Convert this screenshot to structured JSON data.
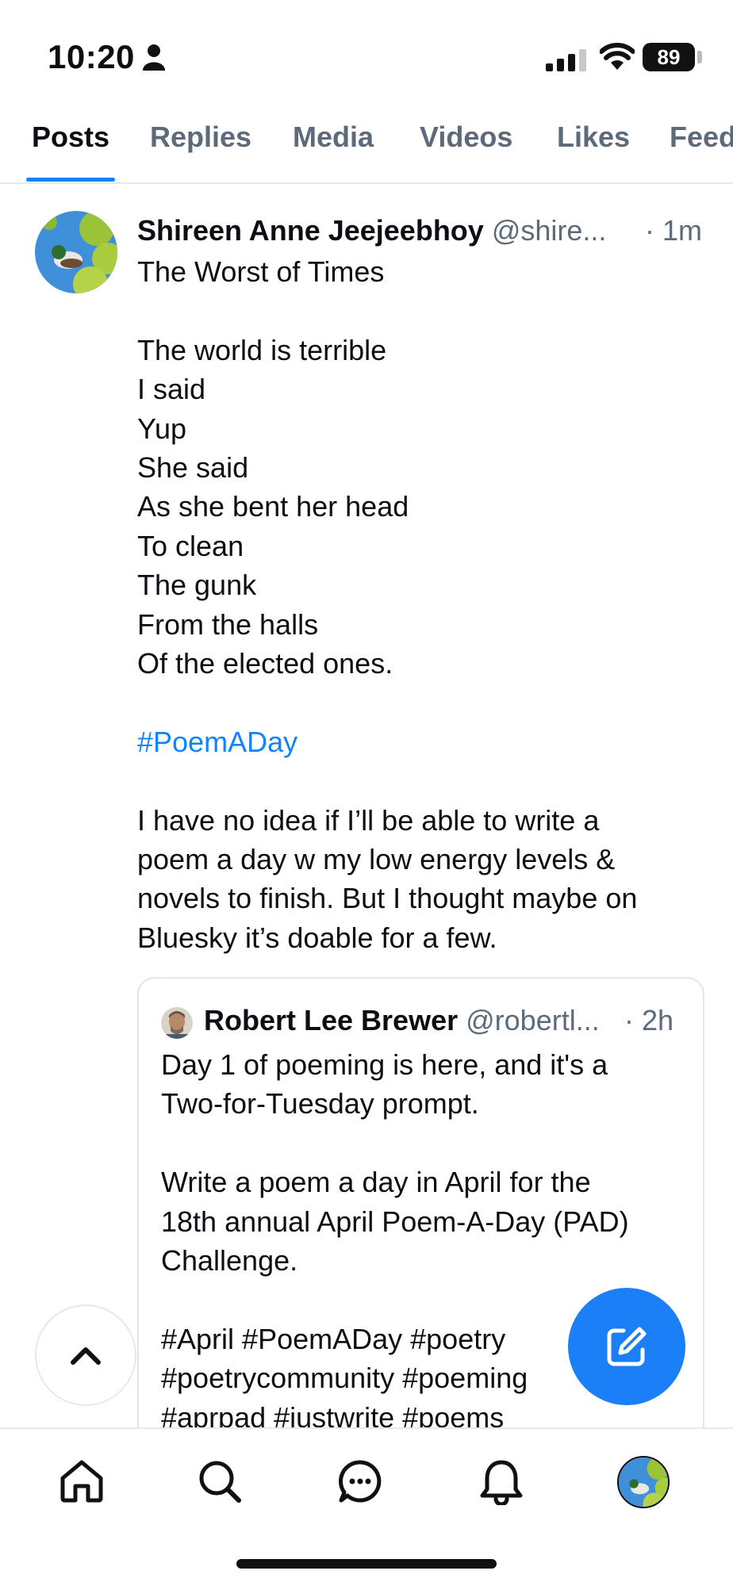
{
  "status_bar": {
    "time": "10:20",
    "battery": "89"
  },
  "tabs": [
    {
      "label": "Posts",
      "active": true
    },
    {
      "label": "Replies"
    },
    {
      "label": "Media"
    },
    {
      "label": "Videos"
    },
    {
      "label": "Likes"
    },
    {
      "label": "Feeds"
    }
  ],
  "post": {
    "author": "Shireen Anne Jeejeebhoy",
    "handle": "@shire...",
    "time": "· 1m",
    "lines": [
      "The Worst of Times",
      "",
      "The world is terrible",
      "I said",
      "Yup",
      "She said",
      "As she bent her head",
      "To clean",
      "The gunk",
      "From the halls",
      "Of the elected ones.",
      "",
      "#PoemADay",
      "",
      "I have no idea if I’ll be able to write a",
      "poem a day w my low energy levels &",
      "novels to finish. But I thought maybe on",
      "Bluesky it’s doable for a few."
    ]
  },
  "quote": {
    "author": "Robert Lee Brewer",
    "handle": "@robertl...",
    "time": "· 2h",
    "lines": [
      "Day 1 of poeming is here, and it's a",
      "Two-for-Tuesday prompt.",
      "",
      "Write a poem a day in April for the",
      "18th annual April Poem-A-Day (PAD)",
      "Challenge.",
      "",
      "#April #PoemADay #poetry",
      "#poetrycommunity #poeming",
      "#aprpad #justwrite #poems"
    ]
  },
  "icons": {
    "scroll_top": "chevron-up-icon",
    "compose": "compose-icon",
    "nav": [
      "home-icon",
      "search-icon",
      "chat-icon",
      "bell-icon",
      "profile-avatar"
    ]
  },
  "colors": {
    "accent": "#1083fe",
    "compose": "#1b7ff8",
    "muted": "#5c6a79"
  }
}
